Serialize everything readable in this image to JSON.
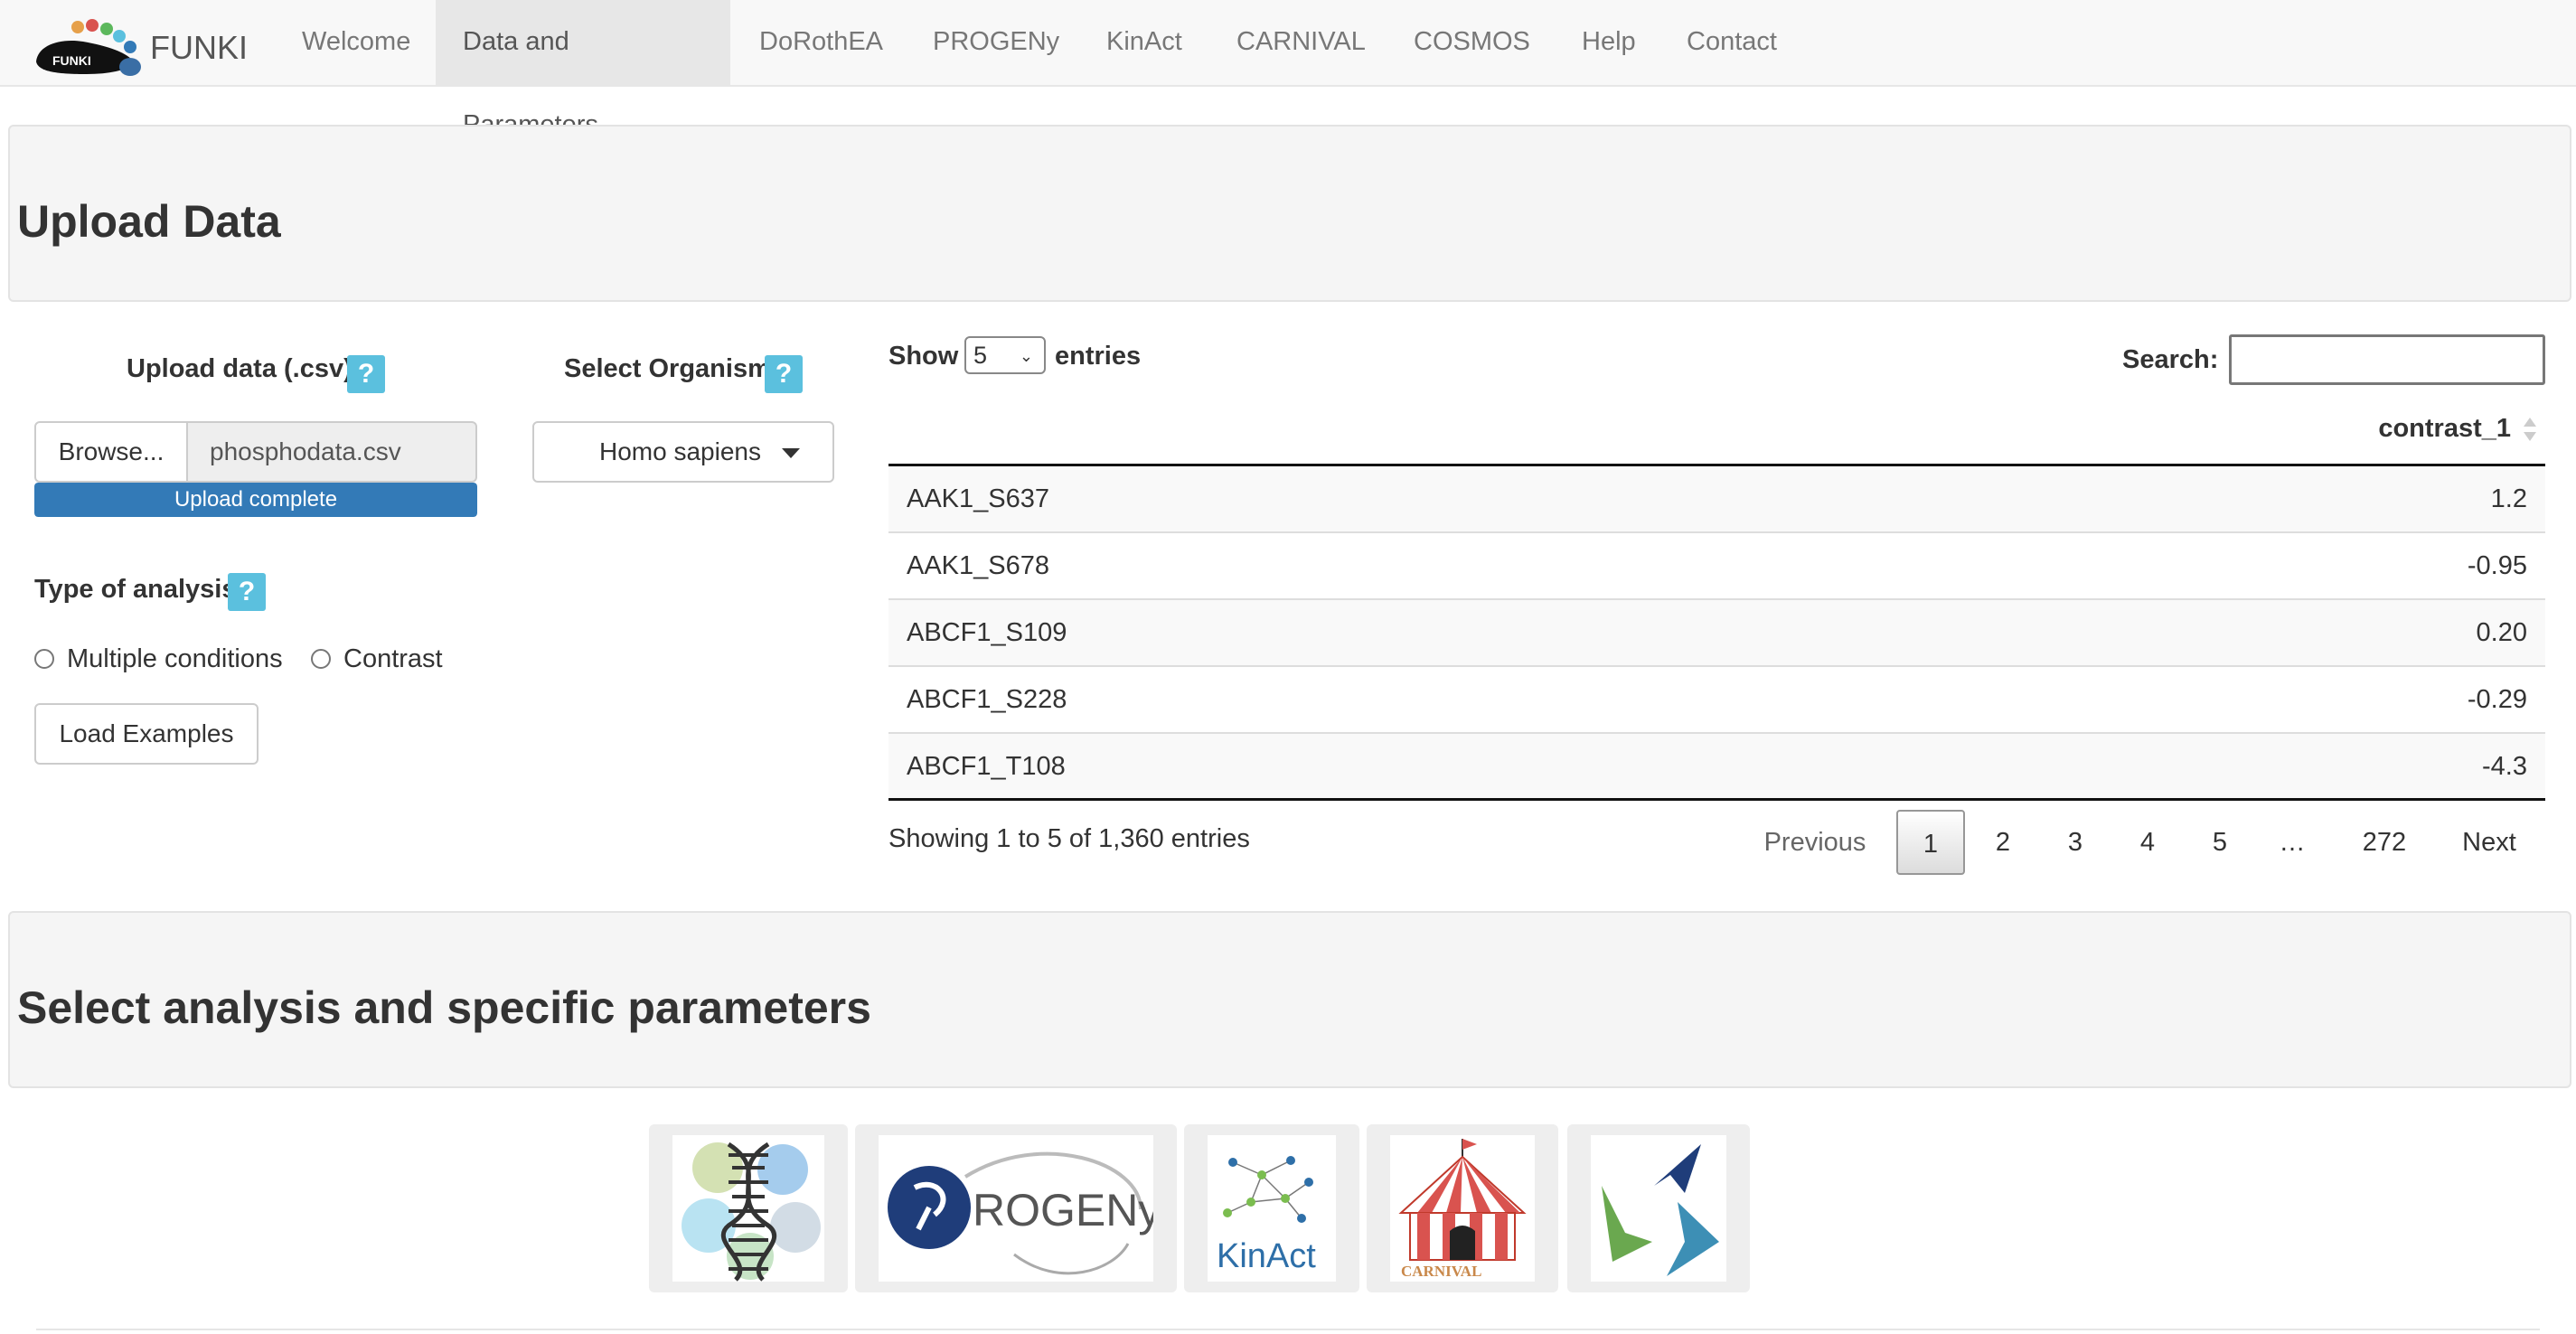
{
  "navbar": {
    "brand": "FUNKI",
    "logo_text": "FUNKI",
    "items": [
      {
        "label": "Welcome",
        "active": false
      },
      {
        "label": "Data and Parameters",
        "active": true
      },
      {
        "label": "DoRothEA",
        "active": false
      },
      {
        "label": "PROGENy",
        "active": false
      },
      {
        "label": "KinAct",
        "active": false
      },
      {
        "label": "CARNIVAL",
        "active": false
      },
      {
        "label": "COSMOS",
        "active": false
      },
      {
        "label": "Help",
        "active": false
      },
      {
        "label": "Contact",
        "active": false
      }
    ]
  },
  "upload_section": {
    "title": "Upload Data",
    "upload_label": "Upload data (.csv)",
    "help_glyph": "?",
    "browse_label": "Browse...",
    "file_name": "phosphodata.csv",
    "progress_text": "Upload complete",
    "progress": 1.0,
    "organism_label": "Select Organism",
    "organism_value": "Homo sapiens",
    "analysis_label": "Type of analysis",
    "radio_multiple": "Multiple conditions",
    "radio_contrast": "Contrast",
    "load_examples": "Load Examples"
  },
  "table": {
    "show_label": "Show",
    "entries_label": "entries",
    "length_value": "5",
    "search_label": "Search:",
    "search_value": "",
    "column": "contrast_1",
    "rows": [
      {
        "id": "AAK1_S637",
        "value": "1.2"
      },
      {
        "id": "AAK1_S678",
        "value": "-0.95"
      },
      {
        "id": "ABCF1_S109",
        "value": "0.20"
      },
      {
        "id": "ABCF1_S228",
        "value": "-0.29"
      },
      {
        "id": "ABCF1_T108",
        "value": "-4.3"
      }
    ],
    "info": "Showing 1 to 5 of 1,360 entries",
    "pagination": {
      "previous": "Previous",
      "pages": [
        "1",
        "2",
        "3",
        "4",
        "5",
        "…",
        "272"
      ],
      "current": "1",
      "next": "Next"
    }
  },
  "analysis_section": {
    "title": "Select analysis and specific parameters",
    "tiles": [
      {
        "name": "dorothea-logo",
        "label": ""
      },
      {
        "name": "progeny-logo",
        "label": "ROGENy"
      },
      {
        "name": "kinact-logo",
        "label": "KinAct"
      },
      {
        "name": "carnival-logo",
        "label": "CARNIVAL"
      },
      {
        "name": "cosmos-logo",
        "label": ""
      }
    ]
  },
  "colors": {
    "help_button": "#5bc0de",
    "progress_bar": "#337ab7",
    "navbar_bg": "#f8f8f8",
    "well_bg": "#f5f5f5"
  }
}
